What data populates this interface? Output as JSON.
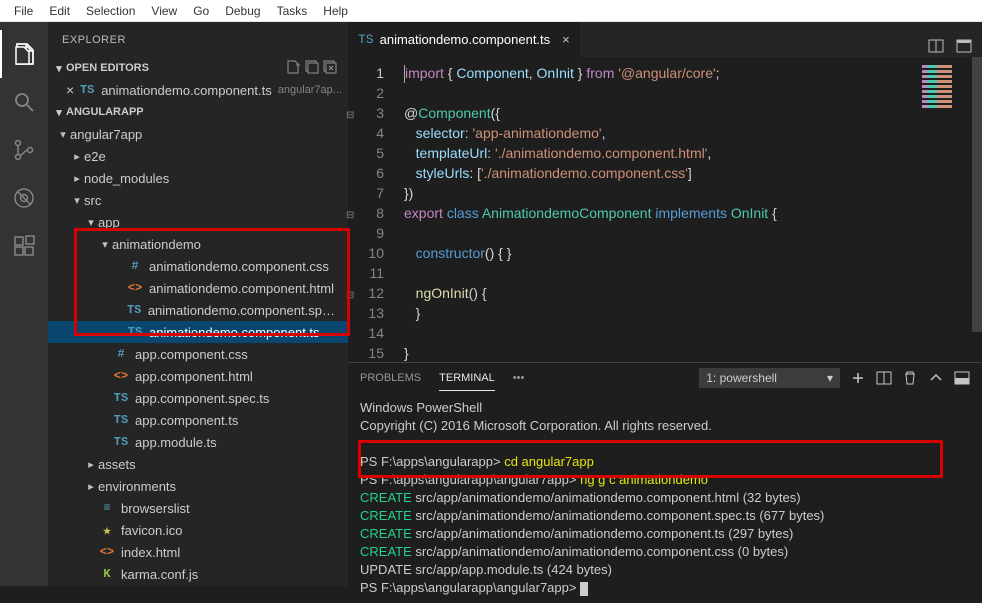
{
  "menu": [
    "File",
    "Edit",
    "Selection",
    "View",
    "Go",
    "Debug",
    "Tasks",
    "Help"
  ],
  "sidebar": {
    "title": "EXPLORER",
    "sections": {
      "openEditors": {
        "label": "OPEN EDITORS",
        "items": [
          {
            "icon": "TS",
            "icon_color": "c-blue",
            "name": "animationdemo.component.ts",
            "hint": "angular7ap..."
          }
        ]
      },
      "workspace": {
        "label": "ANGULARAPP",
        "tree": [
          {
            "indent": 0,
            "twisty": "down",
            "icon": "",
            "name": "angular7app"
          },
          {
            "indent": 1,
            "twisty": "right",
            "icon": "",
            "name": "e2e"
          },
          {
            "indent": 1,
            "twisty": "right",
            "icon": "",
            "name": "node_modules"
          },
          {
            "indent": 1,
            "twisty": "down",
            "icon": "",
            "name": "src"
          },
          {
            "indent": 2,
            "twisty": "down",
            "icon": "",
            "name": "app"
          },
          {
            "indent": 3,
            "twisty": "down",
            "icon": "",
            "name": "animationdemo"
          },
          {
            "indent": 4,
            "twisty": "none",
            "icon": "#",
            "icon_color": "c-blue",
            "name": "animationdemo.component.css"
          },
          {
            "indent": 4,
            "twisty": "none",
            "icon": "<>",
            "icon_color": "c-orange",
            "name": "animationdemo.component.html"
          },
          {
            "indent": 4,
            "twisty": "none",
            "icon": "TS",
            "icon_color": "c-blue",
            "name": "animationdemo.component.spec.ts"
          },
          {
            "indent": 4,
            "twisty": "none",
            "icon": "TS",
            "icon_color": "c-blue",
            "name": "animationdemo.component.ts",
            "selected": true
          },
          {
            "indent": 3,
            "twisty": "none",
            "icon": "#",
            "icon_color": "c-blue",
            "name": "app.component.css"
          },
          {
            "indent": 3,
            "twisty": "none",
            "icon": "<>",
            "icon_color": "c-orange",
            "name": "app.component.html"
          },
          {
            "indent": 3,
            "twisty": "none",
            "icon": "TS",
            "icon_color": "c-blue",
            "name": "app.component.spec.ts"
          },
          {
            "indent": 3,
            "twisty": "none",
            "icon": "TS",
            "icon_color": "c-blue",
            "name": "app.component.ts"
          },
          {
            "indent": 3,
            "twisty": "none",
            "icon": "TS",
            "icon_color": "c-blue",
            "name": "app.module.ts"
          },
          {
            "indent": 2,
            "twisty": "right",
            "icon": "",
            "name": "assets"
          },
          {
            "indent": 2,
            "twisty": "right",
            "icon": "",
            "name": "environments"
          },
          {
            "indent": 2,
            "twisty": "none",
            "icon": "≡",
            "icon_color": "c-blue",
            "name": "browserslist"
          },
          {
            "indent": 2,
            "twisty": "none",
            "icon": "★",
            "icon_color": "c-yellow",
            "name": "favicon.ico"
          },
          {
            "indent": 2,
            "twisty": "none",
            "icon": "<>",
            "icon_color": "c-orange",
            "name": "index.html"
          },
          {
            "indent": 2,
            "twisty": "none",
            "icon": "K",
            "icon_color": "c-green",
            "name": "karma.conf.js"
          }
        ]
      }
    }
  },
  "editor": {
    "tab_icon": "TS",
    "tab_name": "animationdemo.component.ts",
    "lines": [
      [
        {
          "t": "import ",
          "c": "tok-kw"
        },
        {
          "t": "{ ",
          "c": "tok-punc"
        },
        {
          "t": "Component",
          "c": "tok-id"
        },
        {
          "t": ", ",
          "c": "tok-punc"
        },
        {
          "t": "OnInit",
          "c": "tok-id"
        },
        {
          "t": " } ",
          "c": "tok-punc"
        },
        {
          "t": "from ",
          "c": "tok-kw"
        },
        {
          "t": "'@angular/core'",
          "c": "tok-str"
        },
        {
          "t": ";",
          "c": "tok-punc"
        }
      ],
      [],
      [
        {
          "t": "@",
          "c": "tok-punc"
        },
        {
          "t": "Component",
          "c": "tok-dec"
        },
        {
          "t": "({",
          "c": "tok-punc"
        }
      ],
      [
        {
          "t": "   ",
          "c": ""
        },
        {
          "t": "selector",
          "c": "tok-id"
        },
        {
          "t": ": ",
          "c": "tok-punc"
        },
        {
          "t": "'app-animationdemo'",
          "c": "tok-str"
        },
        {
          "t": ",",
          "c": "tok-punc"
        }
      ],
      [
        {
          "t": "   ",
          "c": ""
        },
        {
          "t": "templateUrl",
          "c": "tok-id"
        },
        {
          "t": ": ",
          "c": "tok-punc"
        },
        {
          "t": "'./animationdemo.component.html'",
          "c": "tok-str"
        },
        {
          "t": ",",
          "c": "tok-punc"
        }
      ],
      [
        {
          "t": "   ",
          "c": ""
        },
        {
          "t": "styleUrls",
          "c": "tok-id"
        },
        {
          "t": ": [",
          "c": "tok-punc"
        },
        {
          "t": "'./animationdemo.component.css'",
          "c": "tok-str"
        },
        {
          "t": "]",
          "c": "tok-punc"
        }
      ],
      [
        {
          "t": "})",
          "c": "tok-punc"
        }
      ],
      [
        {
          "t": "export ",
          "c": "tok-kw"
        },
        {
          "t": "class ",
          "c": "tok-blue"
        },
        {
          "t": "AnimationdemoComponent ",
          "c": "tok-type"
        },
        {
          "t": "implements ",
          "c": "tok-blue"
        },
        {
          "t": "OnInit ",
          "c": "tok-type"
        },
        {
          "t": "{",
          "c": "tok-punc"
        }
      ],
      [],
      [
        {
          "t": "   ",
          "c": ""
        },
        {
          "t": "constructor",
          "c": "tok-blue"
        },
        {
          "t": "() { }",
          "c": "tok-punc"
        }
      ],
      [],
      [
        {
          "t": "   ",
          "c": ""
        },
        {
          "t": "ngOnInit",
          "c": "tok-func"
        },
        {
          "t": "() {",
          "c": "tok-punc"
        }
      ],
      [
        {
          "t": "   }",
          "c": "tok-punc"
        }
      ],
      [],
      [
        {
          "t": "}",
          "c": "tok-punc"
        }
      ]
    ],
    "highlighted_line": 1,
    "line_count": 15
  },
  "panel": {
    "tabs": [
      "PROBLEMS",
      "TERMINAL"
    ],
    "active": 1,
    "more": "•••",
    "dropdown": "1: powershell"
  },
  "terminal": {
    "intro": [
      "Windows PowerShell",
      "Copyright (C) 2016 Microsoft Corporation. All rights reserved.",
      ""
    ],
    "lines": [
      [
        {
          "t": "PS F:\\apps\\angularapp> ",
          "c": "w"
        },
        {
          "t": "cd angular7app",
          "c": "y"
        }
      ],
      [
        {
          "t": "PS F:\\apps\\angularapp\\angular7app> ",
          "c": "w"
        },
        {
          "t": "ng g c animationdemo",
          "c": "y"
        }
      ],
      [
        {
          "t": "CREATE",
          "c": "g"
        },
        {
          "t": " src/app/animationdemo/animationdemo.component.html (32 bytes)",
          "c": "w"
        }
      ],
      [
        {
          "t": "CREATE",
          "c": "g"
        },
        {
          "t": " src/app/animationdemo/animationdemo.component.spec.ts (677 bytes)",
          "c": "w"
        }
      ],
      [
        {
          "t": "CREATE",
          "c": "g"
        },
        {
          "t": " src/app/animationdemo/animationdemo.component.ts (297 bytes)",
          "c": "w"
        }
      ],
      [
        {
          "t": "CREATE",
          "c": "g"
        },
        {
          "t": " src/app/animationdemo/animationdemo.component.css (0 bytes)",
          "c": "w"
        }
      ],
      [
        {
          "t": "UPDATE",
          "c": "w"
        },
        {
          "t": " src/app/app.module.ts (424 bytes)",
          "c": "w"
        }
      ],
      [
        {
          "t": "PS F:\\apps\\angularapp\\angular7app> ",
          "c": "w"
        }
      ]
    ]
  }
}
